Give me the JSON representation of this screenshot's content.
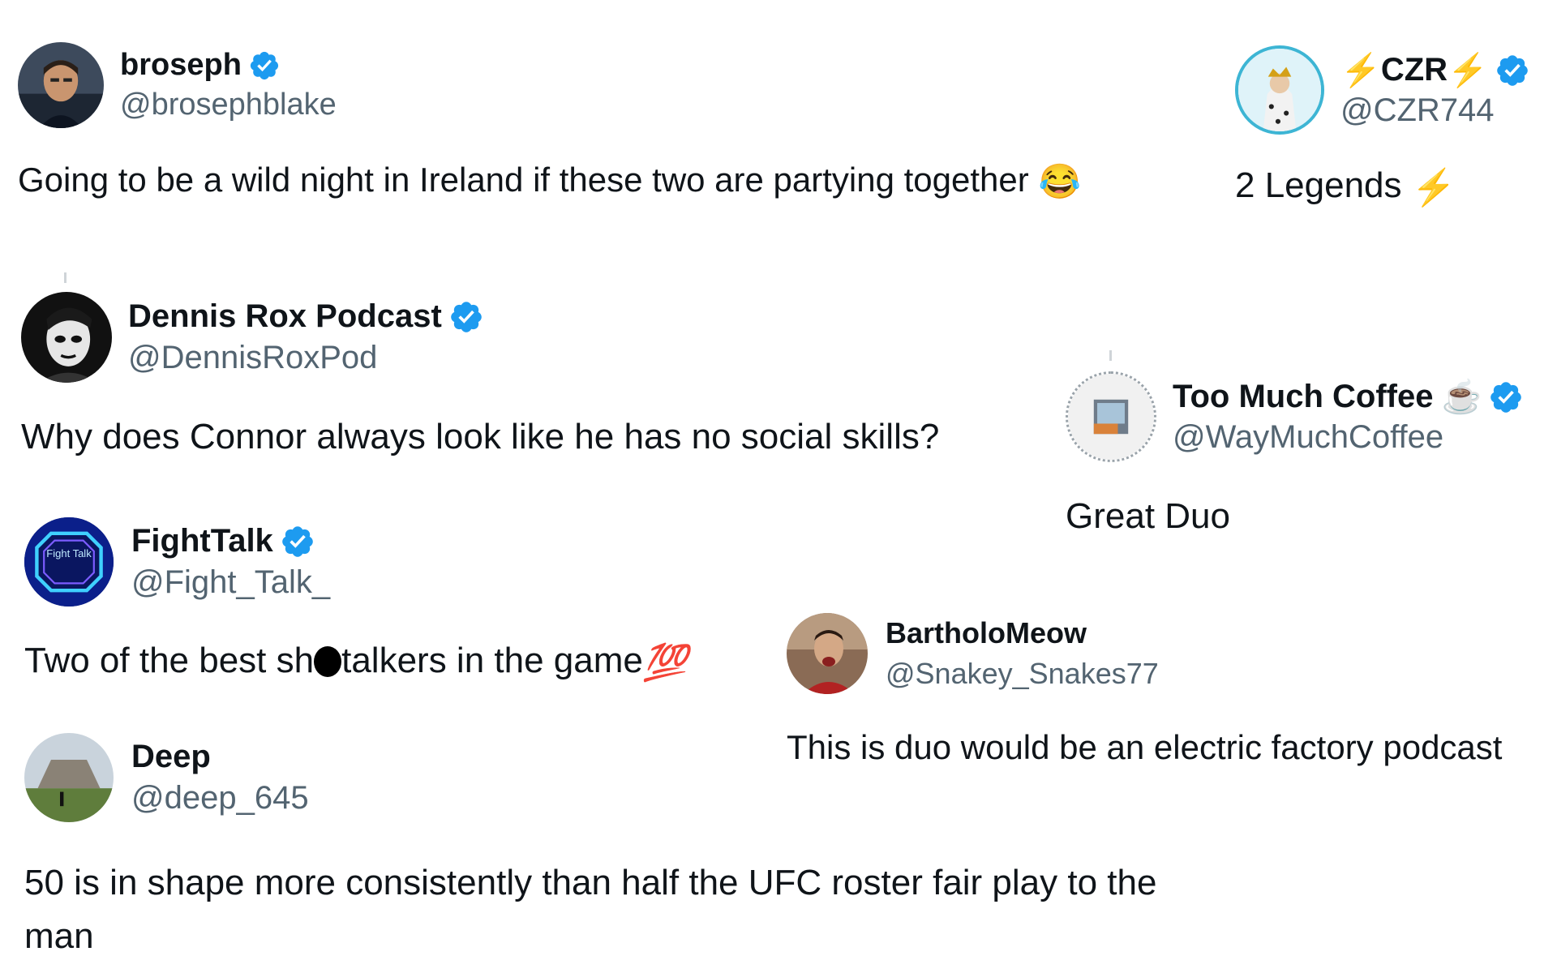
{
  "tweets": [
    {
      "display_name": "broseph",
      "handle": "@brosephblake",
      "verified": true,
      "text": "Going to be a wild night in Ireland if these two are partying together",
      "emoji": "😂"
    },
    {
      "display_name": "CZR",
      "name_prefix_emoji": "⚡",
      "name_suffix_emoji": "⚡",
      "handle": "@CZR744",
      "verified": true,
      "text": "2 Legends",
      "emoji": "⚡"
    },
    {
      "display_name": "Dennis Rox Podcast",
      "handle": "@DennisRoxPod",
      "verified": true,
      "text": "Why does Connor always look like he has no social skills?"
    },
    {
      "display_name": "Too Much Coffee",
      "name_suffix_emoji": "☕",
      "handle": "@WayMuchCoffee",
      "verified": true,
      "text": "Great Duo"
    },
    {
      "display_name": "FightTalk",
      "handle": "@Fight_Talk_",
      "verified": true,
      "avatar_text": "Fight Talk",
      "text_before": "Two of the best sh",
      "text_after": "talkers in the game",
      "emoji": "💯"
    },
    {
      "display_name": "BartholoMeow",
      "handle": "@Snakey_Snakes77",
      "verified": false,
      "text": "This is duo would be an electric factory podcast"
    },
    {
      "display_name": "Deep",
      "handle": "@deep_645",
      "verified": false,
      "text_line1": "50 is in shape more consistently than half the UFC roster fair play to the",
      "text_line2": "man"
    }
  ],
  "colors": {
    "verified_blue": "#1d9bf0",
    "handle_gray": "#536471",
    "text": "#0f1419",
    "bolt": "#f5a623"
  }
}
